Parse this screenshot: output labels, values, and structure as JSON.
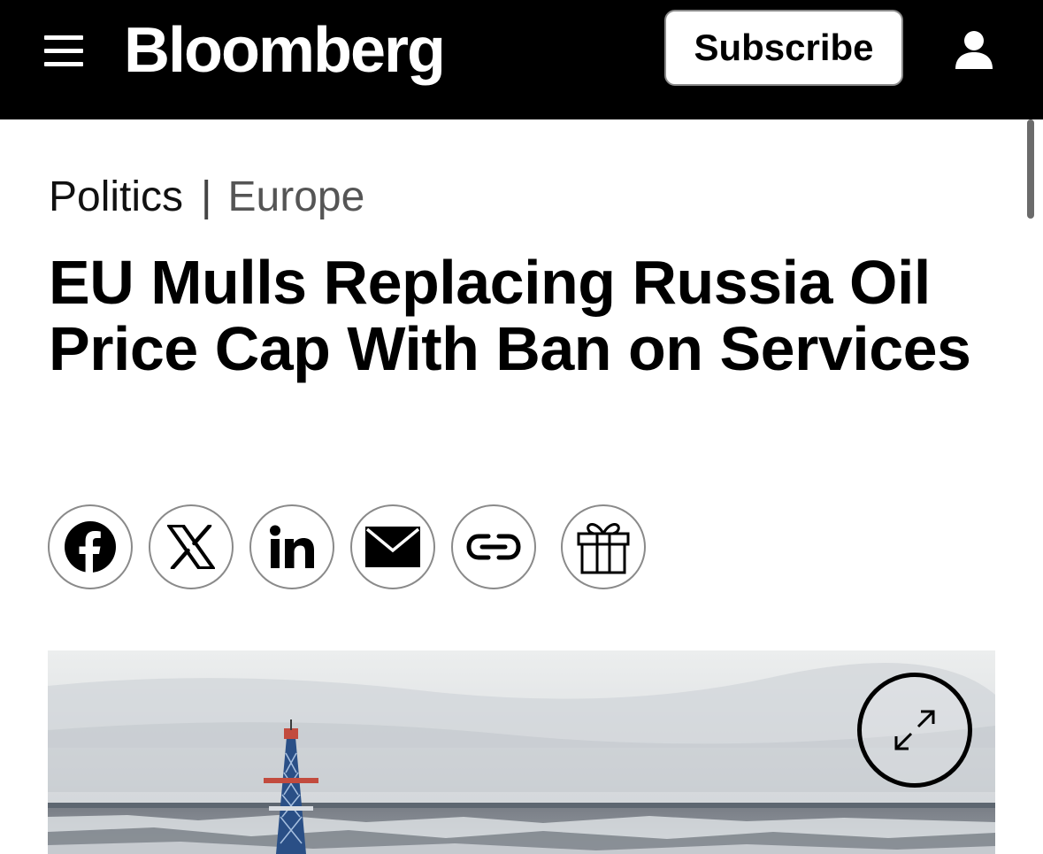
{
  "header": {
    "brand": "Bloomberg",
    "subscribe_label": "Subscribe",
    "menu_icon": "hamburger-menu-icon",
    "account_icon": "user-account-icon"
  },
  "breadcrumb": {
    "section": "Politics",
    "separator": "|",
    "region": "Europe"
  },
  "article": {
    "headline": "EU Mulls Replacing Russia Oil Price Cap With Ban on Services"
  },
  "share": [
    {
      "icon": "facebook-icon"
    },
    {
      "icon": "x-twitter-icon"
    },
    {
      "icon": "linkedin-icon"
    },
    {
      "icon": "email-icon"
    },
    {
      "icon": "copy-link-icon"
    },
    {
      "icon": "gift-article-icon"
    }
  ],
  "hero_image": {
    "description_icon": "oil-rig-photo",
    "expand_icon": "expand-arrows-icon"
  },
  "colors": {
    "header_bg": "#000000",
    "page_bg": "#ffffff",
    "crumb_secondary": "#555555",
    "border_gray": "#8a8a8a"
  }
}
